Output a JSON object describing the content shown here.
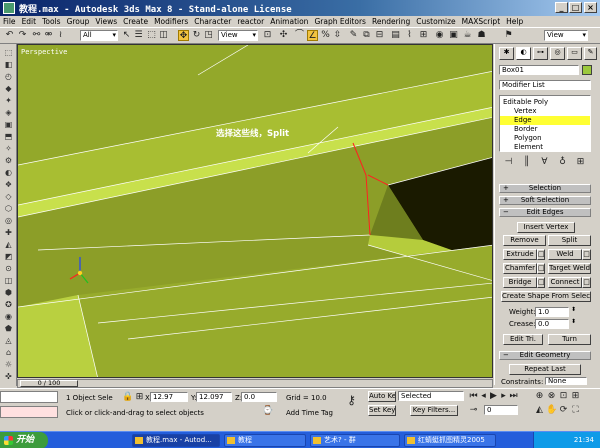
{
  "window": {
    "title": "教程.max - Autodesk 3ds Max 8 - Stand-alone License",
    "buttons": [
      "_",
      "□",
      "×"
    ]
  },
  "menu": [
    "File",
    "Edit",
    "Tools",
    "Group",
    "Views",
    "Create",
    "Modifiers",
    "Character",
    "reactor",
    "Animation",
    "Graph Editors",
    "Rendering",
    "Customize",
    "MAXScript",
    "Help"
  ],
  "toolbar": {
    "selection_filter": "All",
    "ref_coord": "View",
    "named_selection": "View"
  },
  "viewport": {
    "label": "Perspective",
    "annotation": "选择这些线，Split",
    "colors": {
      "face_top": "#9bb02c",
      "face_light": "#c5dc48",
      "face_dark": "#1a1a00",
      "edge": "#ffffff",
      "selected_edge": "#ff2020"
    }
  },
  "panel": {
    "object_name": "Box01",
    "object_color": "#9cc83c",
    "modifier_list": "Modifier List",
    "stack": [
      "Editable Poly",
      "Vertex",
      "Edge",
      "Border",
      "Polygon",
      "Element"
    ],
    "rollouts": {
      "selection": "Selection",
      "soft_selection": "Soft Selection",
      "edit_edges": "Edit Edges",
      "edit_geometry": "Edit Geometry"
    },
    "edit_edges": {
      "insert_vertex": "Insert Vertex",
      "remove": "Remove",
      "split": "Split",
      "extrude": "Extrude",
      "weld": "Weld",
      "chamfer": "Chamfer",
      "target_weld": "Target Weld",
      "bridge": "Bridge",
      "connect": "Connect",
      "create_shape": "Create Shape From Selection",
      "weight_label": "Weight:",
      "weight_value": "1.0",
      "crease_label": "Crease:",
      "crease_value": "0.0",
      "edit_tri": "Edit Tri.",
      "turn": "Turn"
    },
    "edit_geometry": {
      "repeat_last": "Repeat Last",
      "constraints_label": "Constraints:",
      "constraints_value": "None"
    }
  },
  "timeline": {
    "position": "0 / 100"
  },
  "status": {
    "selection": "1 Object Sele",
    "x_label": "X:",
    "x_value": "12.97",
    "y_label": "Y:",
    "y_value": "12.097",
    "z_label": "Z:",
    "z_value": "0.0",
    "grid": "Grid = 10.0",
    "hint": "Click or click-and-drag to select objects",
    "add_time_tag": "Add Time Tag",
    "auto_key": "Auto Key",
    "set_key": "Set Key",
    "key_mode": "Selected",
    "key_filters": "Key Filters...",
    "frame": "0"
  },
  "taskbar": {
    "start": "开始",
    "tasks": [
      "教程.max - Autod...",
      "教程",
      "艺术? - 群",
      "红蜻蜓抓图精灵2005"
    ],
    "clock": "21:34"
  }
}
